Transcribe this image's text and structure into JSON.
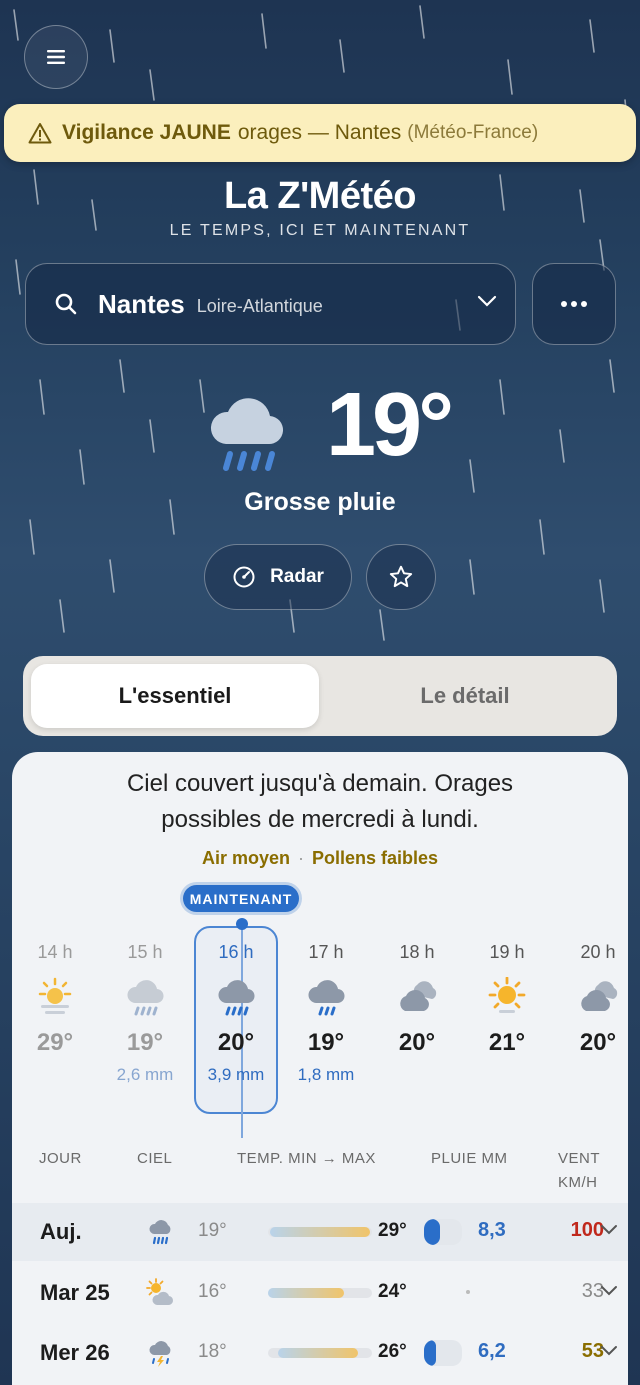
{
  "alert": {
    "level_text": "Vigilance JAUNE",
    "hazard": "orages — Nantes",
    "source": "(Météo-France)"
  },
  "app": {
    "title": "La Z'Météo",
    "subtitle": "LE TEMPS, ICI ET MAINTENANT"
  },
  "search": {
    "city": "Nantes",
    "region": "Loire-Atlantique"
  },
  "current": {
    "temp": "19°",
    "condition": "Grosse pluie",
    "icon": "heavy-rain-icon"
  },
  "actions": {
    "radar_label": "Radar"
  },
  "tabs": [
    {
      "label": "L'essentiel",
      "active": true
    },
    {
      "label": "Le détail",
      "active": false
    }
  ],
  "summary": {
    "text": "Ciel couvert jusqu'à demain. Orages possibles de mercredi à lundi.",
    "air": "Air moyen",
    "pollen": "Pollens faibles"
  },
  "hourly": {
    "now_label": "MAINTENANT",
    "hours": [
      {
        "hour": "14 h",
        "temp": "29°",
        "rain": "",
        "icon": "sun-haze-icon"
      },
      {
        "hour": "15 h",
        "temp": "19°",
        "rain": "2,6 mm",
        "icon": "rain-icon"
      },
      {
        "hour": "16 h",
        "temp": "20°",
        "rain": "3,9 mm",
        "icon": "heavy-rain-icon"
      },
      {
        "hour": "17 h",
        "temp": "19°",
        "rain": "1,8 mm",
        "icon": "rain-icon"
      },
      {
        "hour": "18 h",
        "temp": "20°",
        "rain": "",
        "icon": "overcast-icon"
      },
      {
        "hour": "19 h",
        "temp": "21°",
        "rain": "",
        "icon": "sun-icon"
      },
      {
        "hour": "20 h",
        "temp": "20°",
        "rain": "",
        "icon": "overcast-icon"
      }
    ]
  },
  "daily": {
    "headers": {
      "day": "JOUR",
      "sky": "CIEL",
      "temp": "TEMP. MIN → MAX",
      "rain": "PLUIE MM",
      "wind": "VENT",
      "wind_unit": "KM/H"
    },
    "rows": [
      {
        "day": "Auj.",
        "icon": "heavy-rain-icon",
        "min": "19°",
        "max": "29°",
        "rain": "8,3",
        "wind": "100",
        "wind_color": "#c0281c"
      },
      {
        "day": "Mar 25",
        "icon": "sun-cloud-icon",
        "min": "16°",
        "max": "24°",
        "rain": "",
        "wind": "33",
        "wind_color": "#8a8a8a"
      },
      {
        "day": "Mer 26",
        "icon": "thunderstorm-icon",
        "min": "18°",
        "max": "26°",
        "rain": "6,2",
        "wind": "53",
        "wind_color": "#8a6d00"
      }
    ]
  },
  "colors": {
    "accent": "#2a6ec9",
    "alert_bg": "#fbefbd",
    "alert_text": "#6e5a0c"
  }
}
